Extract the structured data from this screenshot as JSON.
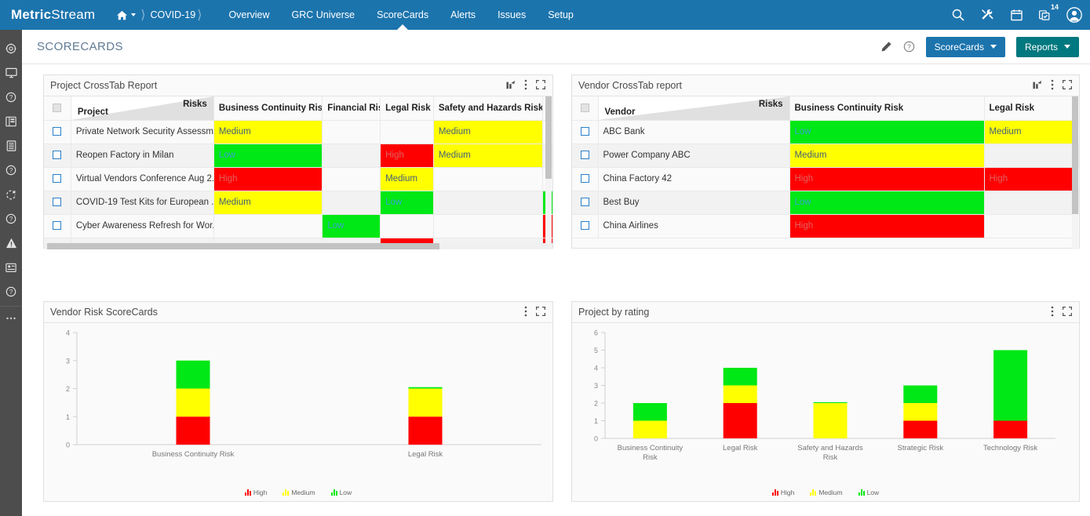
{
  "topnav": {
    "brand_bold": "Metric",
    "brand_light": "Stream",
    "breadcrumbs": [
      {
        "icon": "home-icon",
        "label": ""
      },
      {
        "icon": "",
        "label": "COVID-19"
      }
    ],
    "items": [
      {
        "label": "Overview",
        "active": false
      },
      {
        "label": "GRC Universe",
        "active": false
      },
      {
        "label": "ScoreCards",
        "active": true
      },
      {
        "label": "Alerts",
        "active": false
      },
      {
        "label": "Issues",
        "active": false
      },
      {
        "label": "Setup",
        "active": false
      }
    ],
    "icons": [
      {
        "name": "search-icon"
      },
      {
        "name": "tools-icon"
      },
      {
        "name": "calendar-icon"
      },
      {
        "name": "tasks-icon",
        "badge": "14"
      },
      {
        "name": "user-avatar-icon"
      }
    ],
    "accent_color": "#1c74ad"
  },
  "sidebar": {
    "items": [
      {
        "name": "settings-gear-icon"
      },
      {
        "name": "monitor-icon"
      },
      {
        "name": "help-circle-icon"
      },
      {
        "name": "dashboard-board-icon"
      },
      {
        "name": "list-document-icon"
      },
      {
        "name": "help-circle-icon"
      },
      {
        "name": "refresh-loop-icon"
      },
      {
        "name": "help-circle-icon"
      },
      {
        "name": "warning-triangle-icon"
      },
      {
        "name": "calendar-card-icon"
      },
      {
        "name": "help-circle-icon"
      },
      {
        "name": "more-ellipsis-icon"
      }
    ]
  },
  "header": {
    "title": "SCORECARDS",
    "edit_icon": "pencil-icon",
    "help_icon": "help-circle-icon",
    "scorecards_button": "ScoreCards",
    "reports_button": "Reports",
    "scorecards_color": "#1c74ad",
    "reports_color": "#00787f"
  },
  "panels": {
    "project_crosstab": {
      "title": "Project CrossTab Report",
      "actions": [
        "export-chart-icon",
        "kebab-menu-icon",
        "expand-icon"
      ],
      "split_header": {
        "left": "Project",
        "right": "Risks"
      },
      "columns": [
        "Business Continuity Risk",
        "Financial Risk",
        "Legal Risk",
        "Safety and Hazards Risk"
      ],
      "rows": [
        {
          "project": "Private Network Security Assessm...",
          "cells": [
            {
              "v": "Medium",
              "r": "yel"
            },
            {
              "v": "",
              "r": ""
            },
            {
              "v": "",
              "r": ""
            },
            {
              "v": "Medium",
              "r": "yel"
            }
          ],
          "edge": ""
        },
        {
          "project": "Reopen Factory in Milan",
          "cells": [
            {
              "v": "Low",
              "r": "grn"
            },
            {
              "v": "",
              "r": ""
            },
            {
              "v": "High",
              "r": "red"
            },
            {
              "v": "Medium",
              "r": "yel"
            }
          ],
          "edge": ""
        },
        {
          "project": "Virtual Vendors Conference Aug 2...",
          "cells": [
            {
              "v": "High",
              "r": "red"
            },
            {
              "v": "",
              "r": ""
            },
            {
              "v": "Medium",
              "r": "yel"
            },
            {
              "v": "",
              "r": ""
            }
          ],
          "edge": ""
        },
        {
          "project": "COVID-19 Test Kits for European ...",
          "cells": [
            {
              "v": "Medium",
              "r": "yel"
            },
            {
              "v": "",
              "r": ""
            },
            {
              "v": "Low",
              "r": "grn"
            },
            {
              "v": "",
              "r": ""
            }
          ],
          "edge": "grn"
        },
        {
          "project": "Cyber Awareness Refresh for Wor...",
          "cells": [
            {
              "v": "",
              "r": ""
            },
            {
              "v": "Low",
              "r": "grn"
            },
            {
              "v": "",
              "r": ""
            },
            {
              "v": "",
              "r": ""
            }
          ],
          "edge": "red"
        },
        {
          "project": "",
          "cells": [
            {
              "v": "",
              "r": ""
            },
            {
              "v": "",
              "r": ""
            },
            {
              "v": "",
              "r": "red"
            },
            {
              "v": "",
              "r": ""
            }
          ],
          "edge": "red"
        }
      ]
    },
    "vendor_crosstab": {
      "title": "Vendor CrossTab report",
      "actions": [
        "export-chart-icon",
        "kebab-menu-icon",
        "expand-icon"
      ],
      "split_header": {
        "left": "Vendor",
        "right": "Risks"
      },
      "columns": [
        "Business Continuity Risk",
        "Legal Risk"
      ],
      "rows": [
        {
          "vendor": "ABC Bank",
          "cells": [
            {
              "v": "Low",
              "r": "grn"
            },
            {
              "v": "Medium",
              "r": "yel"
            }
          ]
        },
        {
          "vendor": "Power Company ABC",
          "cells": [
            {
              "v": "Medium",
              "r": "yel"
            },
            {
              "v": "",
              "r": ""
            }
          ]
        },
        {
          "vendor": "China Factory 42",
          "cells": [
            {
              "v": "High",
              "r": "red"
            },
            {
              "v": "High",
              "r": "red"
            }
          ]
        },
        {
          "vendor": "Best Buy",
          "cells": [
            {
              "v": "Low",
              "r": "grn"
            },
            {
              "v": "",
              "r": ""
            }
          ]
        },
        {
          "vendor": "China Airlines",
          "cells": [
            {
              "v": "High",
              "r": "red"
            },
            {
              "v": "",
              "r": ""
            }
          ]
        }
      ]
    },
    "vendor_scorecards": {
      "title": "Vendor Risk ScoreCards",
      "actions": [
        "kebab-menu-icon",
        "expand-icon"
      ]
    },
    "project_by_rating": {
      "title": "Project by rating",
      "actions": [
        "kebab-menu-icon",
        "expand-icon"
      ]
    }
  },
  "chart_data": [
    {
      "id": "vendor_risk_scorecards",
      "type": "bar",
      "stacked": true,
      "title": "Vendor Risk ScoreCards",
      "categories": [
        "Business Continuity Risk",
        "Legal Risk"
      ],
      "series": [
        {
          "name": "High",
          "color": "#fe0000",
          "values": [
            1,
            1
          ]
        },
        {
          "name": "Medium",
          "color": "#ffff00",
          "values": [
            1,
            1
          ]
        },
        {
          "name": "Low",
          "color": "#00e815",
          "values": [
            1,
            0.05
          ]
        }
      ],
      "xlabel": "",
      "ylabel": "",
      "ylim": [
        0,
        4
      ],
      "yticks": [
        0,
        1,
        2,
        3,
        4
      ],
      "grid": false,
      "legend_position": "bottom"
    },
    {
      "id": "project_by_rating",
      "type": "bar",
      "stacked": true,
      "title": "Project by rating",
      "categories": [
        "Business Continuity Risk",
        "Legal Risk",
        "Safety and Hazards Risk",
        "Strategic Risk",
        "Technology Risk"
      ],
      "series": [
        {
          "name": "High",
          "color": "#fe0000",
          "values": [
            0,
            2,
            0,
            1,
            1
          ]
        },
        {
          "name": "Medium",
          "color": "#ffff00",
          "values": [
            1,
            1,
            2,
            1,
            0
          ]
        },
        {
          "name": "Low",
          "color": "#00e815",
          "values": [
            1,
            1,
            0.05,
            1,
            4
          ]
        }
      ],
      "xlabel": "",
      "ylabel": "",
      "ylim": [
        0,
        6
      ],
      "yticks": [
        0,
        1,
        2,
        3,
        4,
        5,
        6
      ],
      "grid": false,
      "legend_position": "bottom"
    }
  ],
  "legend_labels": {
    "high": "High",
    "medium": "Medium",
    "low": "Low"
  },
  "colors": {
    "high": "#fe0000",
    "medium": "#ffff00",
    "low": "#00e815"
  }
}
